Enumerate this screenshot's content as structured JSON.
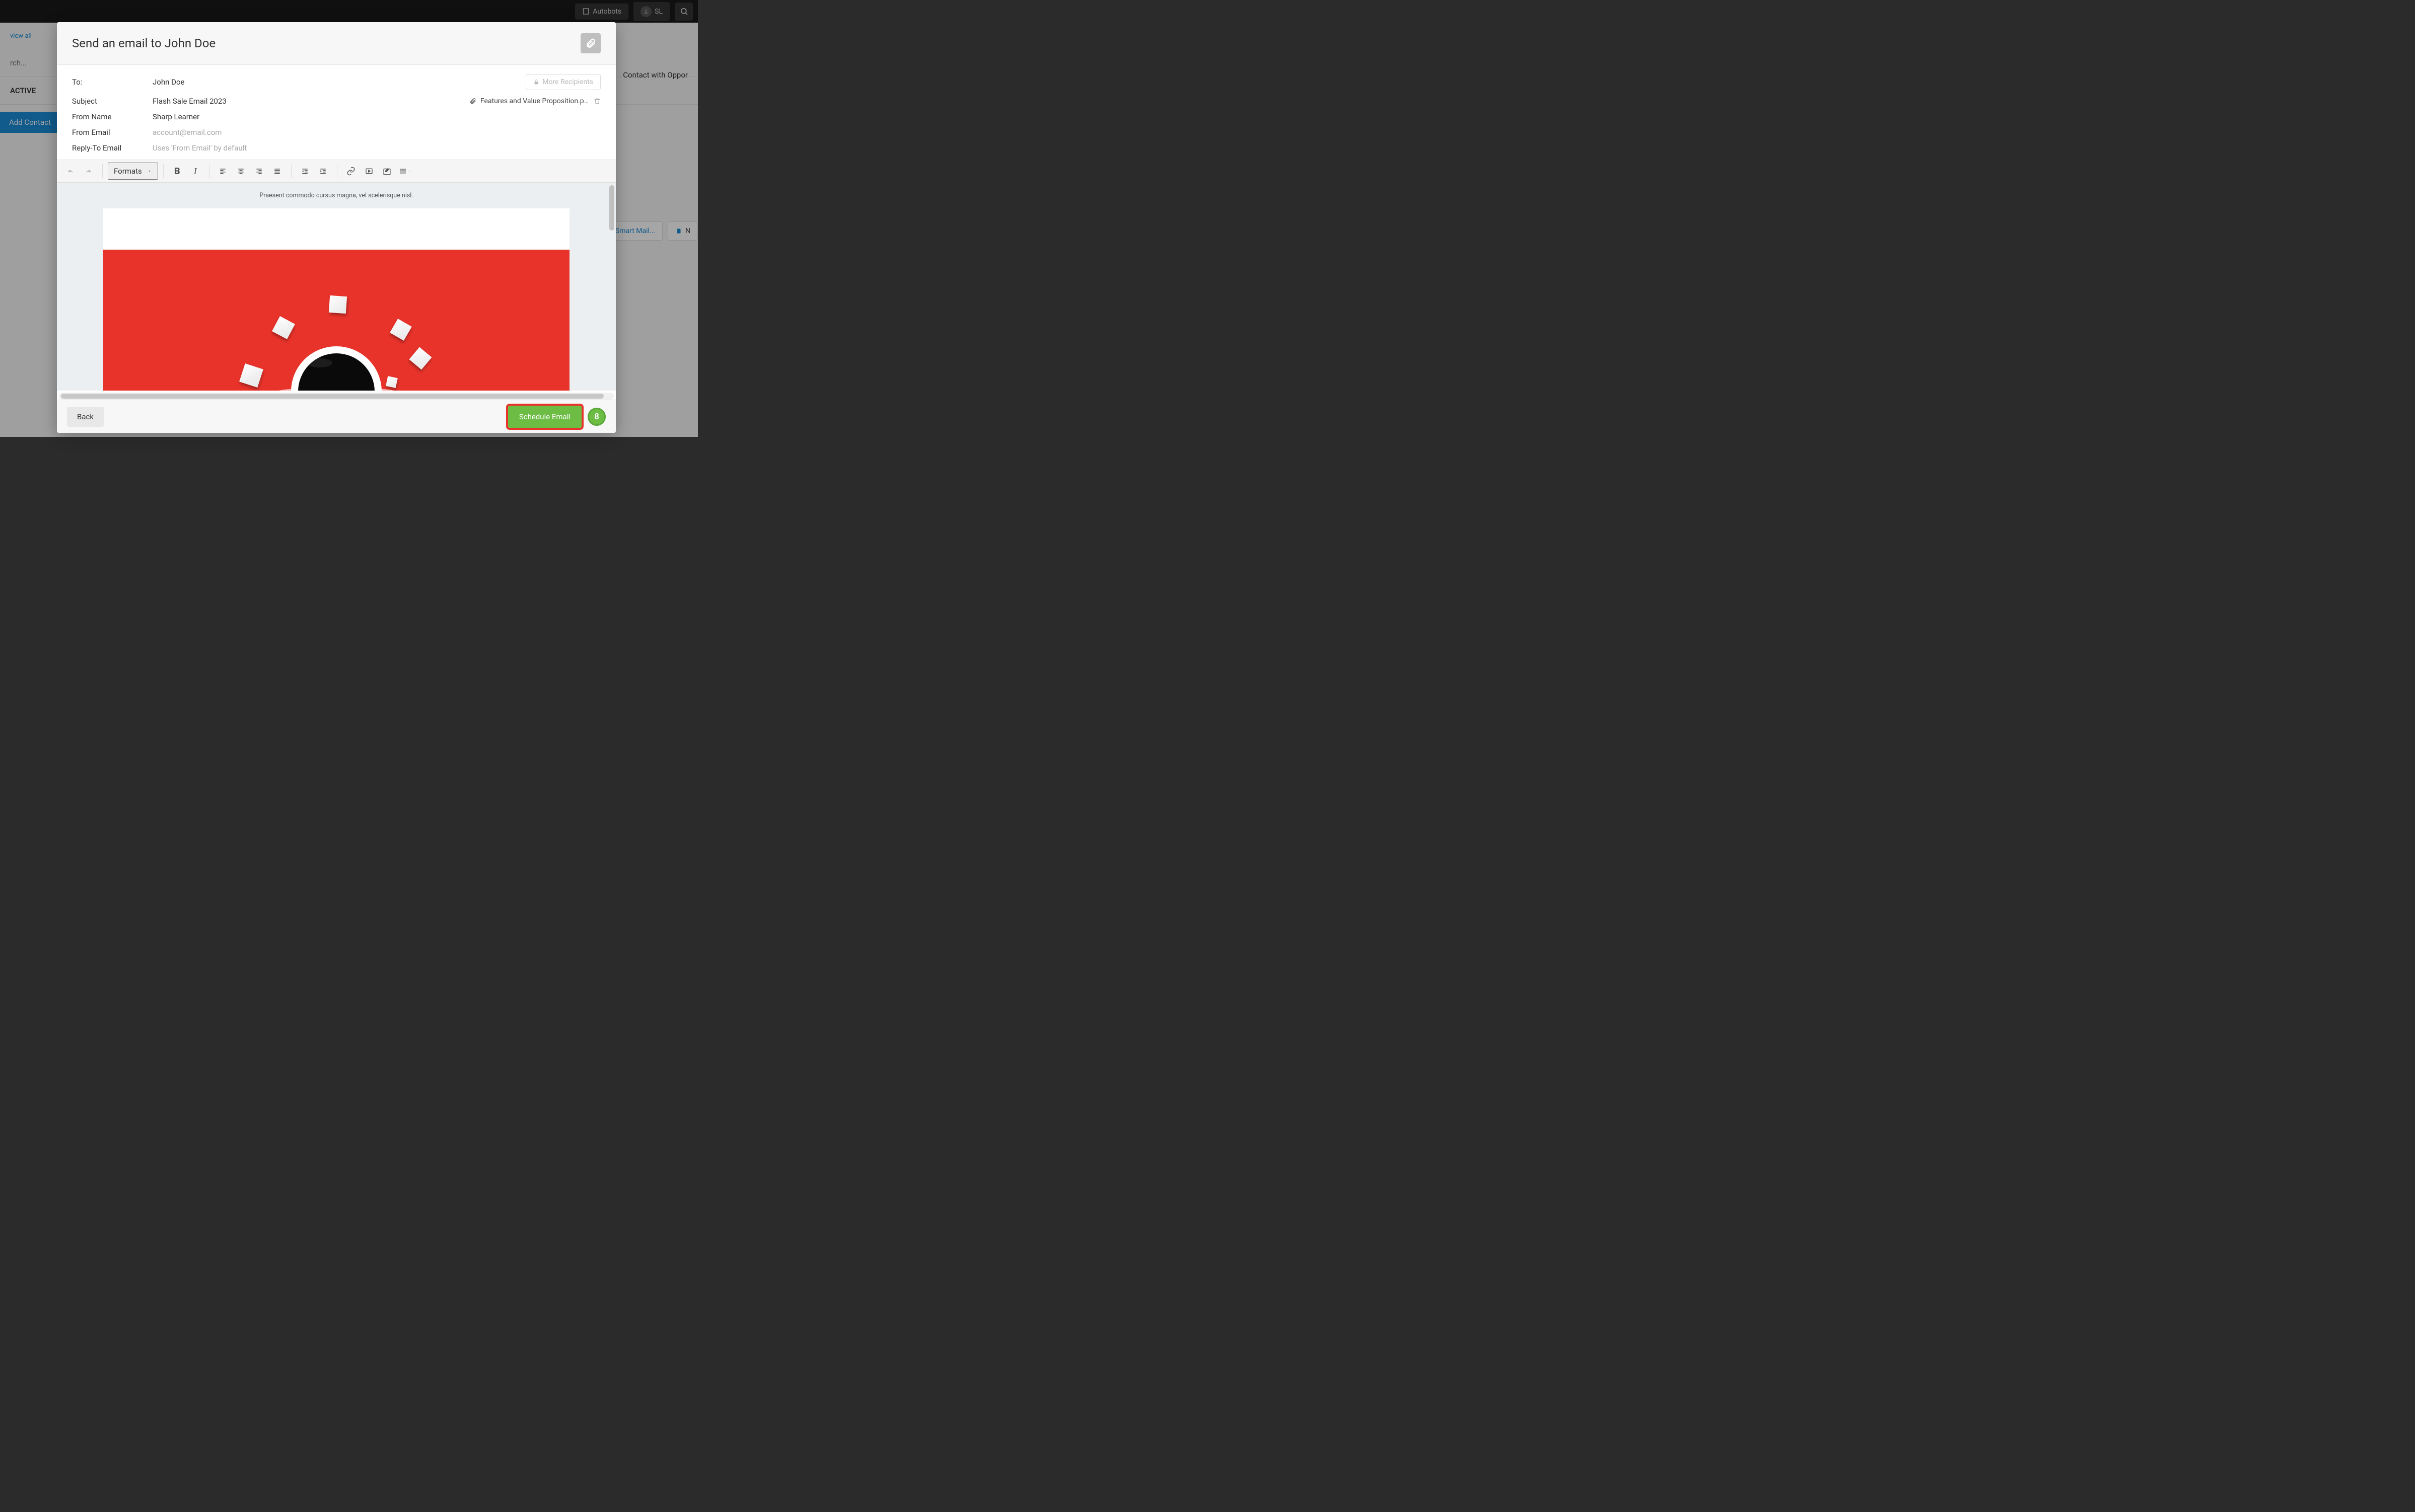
{
  "topbar": {
    "autobots": "Autobots",
    "initials": "SL"
  },
  "background": {
    "view_all": "view all",
    "search_placeholder": "rch...",
    "active": "ACTIVE",
    "add_contact": "Add Contact",
    "contact_opp": "Contact with Oppor",
    "smart_mail": "Smart Mail...",
    "note_btn": "N"
  },
  "modal": {
    "title": "Send an email to John Doe",
    "meta": {
      "to_label": "To:",
      "to_value": "John Doe",
      "subject_label": "Subject",
      "subject_value": "Flash Sale Email 2023",
      "fromname_label": "From Name",
      "fromname_value": "Sharp Learner",
      "fromemail_label": "From Email",
      "fromemail_value": "account@email.com",
      "replyto_label": "Reply-To Email",
      "replyto_placeholder": "Uses 'From Email' by default",
      "more_recipients": "More Recipients",
      "attachment_name": "Features and Value Proposition.p…"
    },
    "toolbar": {
      "formats": "Formats"
    },
    "editor": {
      "preview_text": "Praesent commodo cursus magna, vel scelerisque nisl."
    },
    "footer": {
      "back": "Back",
      "schedule": "Schedule Email",
      "badge": "8"
    }
  }
}
